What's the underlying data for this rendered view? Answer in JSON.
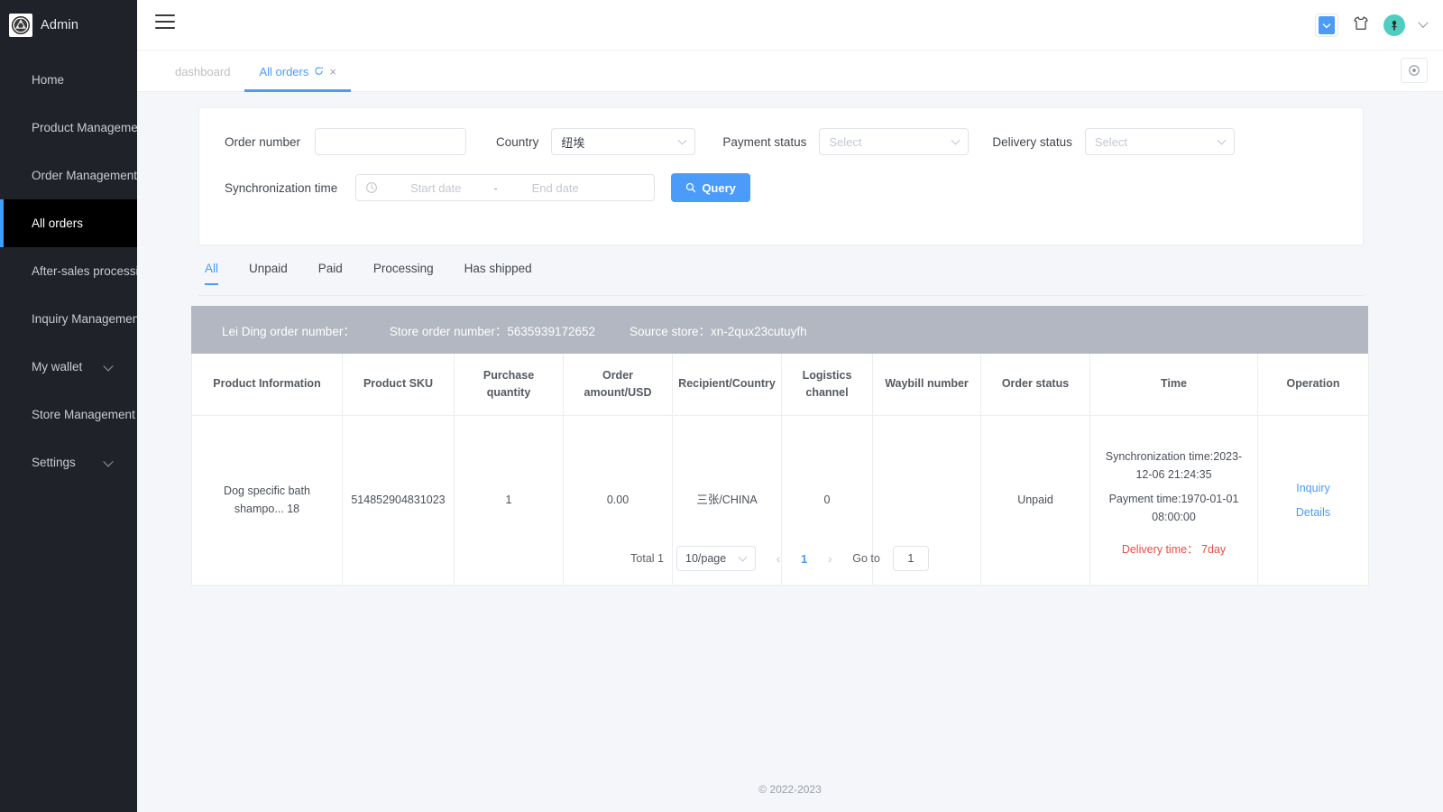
{
  "sidebar": {
    "brand": {
      "name": "Admin",
      "logo_icon": "emblem-logo"
    },
    "items": [
      {
        "label": "Home",
        "active": false,
        "caret": false
      },
      {
        "label": "Product Management",
        "active": false,
        "caret": false
      },
      {
        "label": "Order Management",
        "active": false,
        "caret": false
      },
      {
        "label": "All orders",
        "active": true,
        "caret": false
      },
      {
        "label": "After-sales processing",
        "active": false,
        "caret": false
      },
      {
        "label": "Inquiry Management",
        "active": false,
        "caret": false
      },
      {
        "label": "My wallet",
        "active": false,
        "caret": true
      },
      {
        "label": "Store Management",
        "active": false,
        "caret": false
      },
      {
        "label": "Settings",
        "active": false,
        "caret": true
      }
    ]
  },
  "topbar": {
    "menu_icon": "hamburger-icon",
    "language_icon": "language-chevron-icon",
    "theme_icon": "shirt-icon",
    "avatar_icon": "user-avatar",
    "dropdown_icon": "chevron-down-icon"
  },
  "tabbar": {
    "tabs": [
      {
        "label": "dashboard",
        "active": false,
        "closable": false,
        "refresh": false
      },
      {
        "label": "All orders",
        "active": true,
        "closable": true,
        "refresh": true
      }
    ],
    "close_glyph": "×",
    "action_icon": "target-icon"
  },
  "filters": {
    "order_number": {
      "label": "Order number",
      "value": "",
      "placeholder": ""
    },
    "country": {
      "label": "Country",
      "value": "纽埃",
      "placeholder": ""
    },
    "payment_status": {
      "label": "Payment status",
      "value": "",
      "placeholder": "Select"
    },
    "delivery_status": {
      "label": "Delivery status",
      "value": "",
      "placeholder": "Select"
    },
    "sync_time": {
      "label": "Synchronization time",
      "start_placeholder": "Start date",
      "end_placeholder": "End date",
      "separator": "-",
      "clock_icon": "clock-icon"
    },
    "query_button": {
      "label": "Query",
      "icon": "search-icon",
      "color": "#4b9bfa"
    }
  },
  "status_tabs": [
    {
      "label": "All",
      "active": true
    },
    {
      "label": "Unpaid",
      "active": false
    },
    {
      "label": "Paid",
      "active": false
    },
    {
      "label": "Processing",
      "active": false
    },
    {
      "label": "Has shipped",
      "active": false
    }
  ],
  "order_group": {
    "lei_ding_label": "Lei Ding order number：",
    "lei_ding_value": "",
    "store_order_label": "Store order number：",
    "store_order_value": "5635939172652",
    "source_store_label": "Source store：",
    "source_store_value": "xn-2qux23cutuyfh",
    "bg_color": "#b2b7c1"
  },
  "table": {
    "columns": [
      "Product Information",
      "Product SKU",
      "Purchase quantity",
      "Order amount/USD",
      "Recipient/Country",
      "Logistics channel",
      "Waybill number",
      "Order status",
      "Time",
      "Operation"
    ],
    "rows": [
      {
        "product_information": "Dog specific bath shampo... 18",
        "product_sku": "514852904831023",
        "purchase_quantity": "1",
        "order_amount_usd": "0.00",
        "recipient_country": "三张/CHINA",
        "logistics_channel": "0",
        "waybill_number": "",
        "order_status": "Unpaid",
        "time_sync": "Synchronization time:2023-12-06 21:24:35",
        "time_payment": "Payment time:1970-01-01 08:00:00",
        "time_delivery": "Delivery time： 7day",
        "operations": [
          "Inquiry",
          "Details"
        ]
      }
    ]
  },
  "pagination": {
    "total_label": "Total 1",
    "page_size": "10/page",
    "prev_glyph": "‹",
    "next_glyph": "›",
    "current_page": "1",
    "goto_label": "Go to",
    "goto_value": "1"
  },
  "footer": {
    "copyright": "© 2022-2023"
  },
  "theme": {
    "accent": "#4b9bfa",
    "sidebar_bg": "#20222a",
    "sidebar_active_bg": "#000000",
    "danger": "#f2493f",
    "page_bg": "#f4f6f9"
  }
}
